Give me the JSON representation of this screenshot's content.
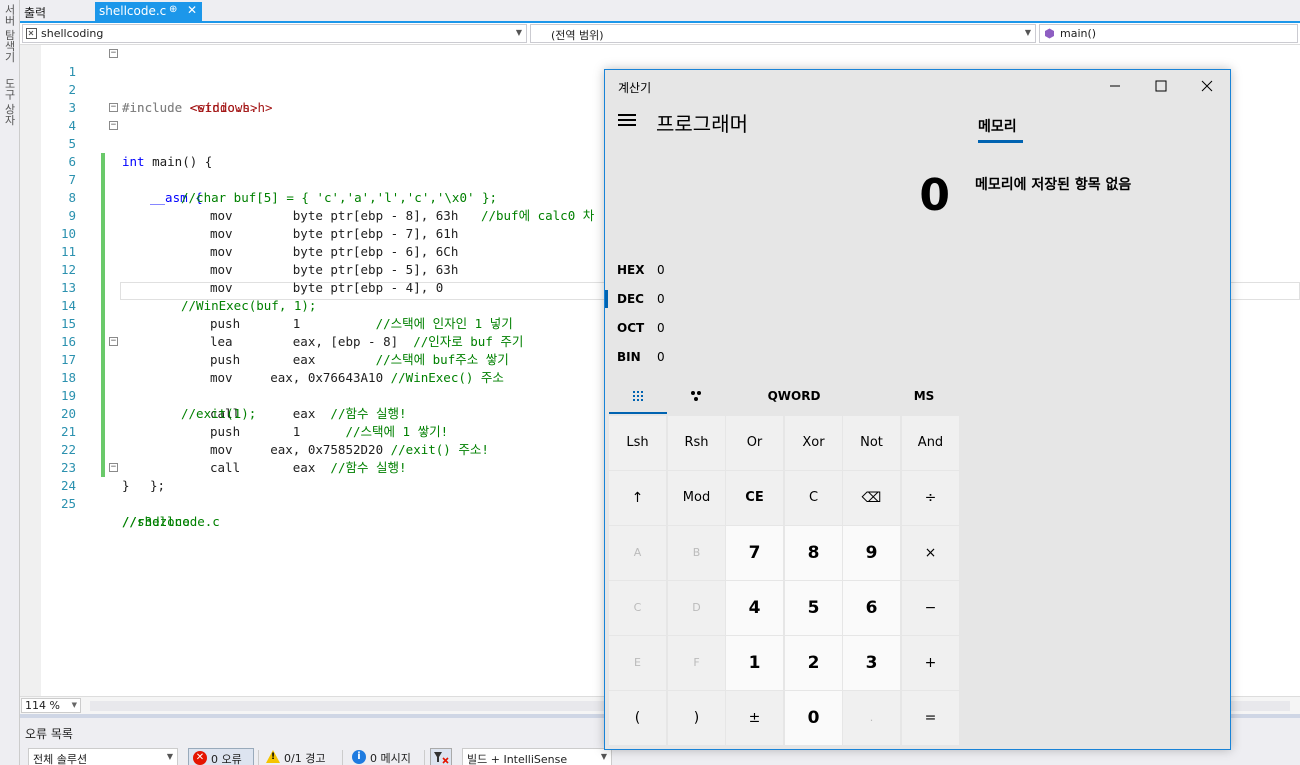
{
  "side_strip": {
    "tab1": "서버 탐색기",
    "tab2": "도구 상자"
  },
  "doc_tabs": {
    "output": "출력",
    "active": "shellcode.c",
    "pin": "⊕",
    "close": "✕"
  },
  "navbar": {
    "file_scope": "shellcoding",
    "global_scope": "(전역 범위)",
    "member": "main()"
  },
  "editor": {
    "lines": [
      {
        "n": "1"
      },
      {
        "n": "2"
      },
      {
        "n": "3"
      },
      {
        "n": "4"
      },
      {
        "n": "5"
      },
      {
        "n": "6"
      },
      {
        "n": "7"
      },
      {
        "n": "8"
      },
      {
        "n": "9"
      },
      {
        "n": "10"
      },
      {
        "n": "11"
      },
      {
        "n": "12"
      },
      {
        "n": "13"
      },
      {
        "n": "14"
      },
      {
        "n": "15"
      },
      {
        "n": "16"
      },
      {
        "n": "17"
      },
      {
        "n": "18"
      },
      {
        "n": "19"
      },
      {
        "n": "20"
      },
      {
        "n": "21"
      },
      {
        "n": "22"
      },
      {
        "n": "23"
      },
      {
        "n": "24"
      },
      {
        "n": "25"
      }
    ],
    "code": {
      "l1_a": "#include ",
      "l1_b": "<stdio.h>",
      "l2_a": "#include ",
      "l2_b": "<windows.h>",
      "l4_a": "int",
      "l4_b": " main() {",
      "l5": "__asm {",
      "l6": "//char buf[5] = { 'c','a','l','c','\\x0' };",
      "l7_a": "mov        byte ptr[ebp - 8], 63h   ",
      "l7_b": "//buf에 calc0 차",
      "l8": "mov        byte ptr[ebp - 7], 61h",
      "l9": "mov        byte ptr[ebp - 6], 6Ch",
      "l10": "mov        byte ptr[ebp - 5], 63h",
      "l11": "mov        byte ptr[ebp - 4], 0",
      "l12": "//WinExec(buf, 1);",
      "l13_a": "push       1          ",
      "l13_b": "//스택에 인자인 1 넣기",
      "l14_a": "lea        eax, [ebp - 8]  ",
      "l14_b": "//인자로 buf 주기",
      "l15_a": "push       eax        ",
      "l15_b": "//스택에 buf주소 쌓기",
      "l16_a": "mov     eax, 0x76643A10 ",
      "l16_b": "//WinExec() 주소",
      "l17_a": "call       eax  ",
      "l17_b": "//함수 실행!",
      "l18": "//exit(1);",
      "l19_a": "push       1      ",
      "l19_b": "//스택에 1 쌓기!",
      "l20_a": "mov     eax, 0x75852D20 ",
      "l20_b": "//exit() 주소!",
      "l21_a": "call       eax  ",
      "l21_b": "//함수 실행!",
      "l22": "};",
      "l23": "}",
      "l24": "//r3dzone",
      "l25": "//shellcode.c"
    }
  },
  "zoom": "114 %",
  "error_list": {
    "title": "오류 목록",
    "scope": "전체 솔루션",
    "errors": "0 오류",
    "warnings": "0/1 경고",
    "messages": "0 메시지",
    "build": "빌드 + IntelliSense"
  },
  "calculator": {
    "title": "계산기",
    "mode": "프로그래머",
    "display": "0",
    "memory_tab": "메모리",
    "memory_empty": "메모리에 저장된 항목 없음",
    "radix": [
      {
        "label": "HEX",
        "value": "0"
      },
      {
        "label": "DEC",
        "value": "0"
      },
      {
        "label": "OCT",
        "value": "0"
      },
      {
        "label": "BIN",
        "value": "0"
      }
    ],
    "word_size": "QWORD",
    "ms": "MS",
    "keys": [
      [
        "Lsh",
        "Rsh",
        "Or",
        "Xor",
        "Not",
        "And"
      ],
      [
        "↑",
        "Mod",
        "CE",
        "C",
        "⌫",
        "÷"
      ],
      [
        "A",
        "B",
        "7",
        "8",
        "9",
        "×"
      ],
      [
        "C",
        "D",
        "4",
        "5",
        "6",
        "−"
      ],
      [
        "E",
        "F",
        "1",
        "2",
        "3",
        "+"
      ],
      [
        "(",
        ")",
        "±",
        "0",
        ".",
        "="
      ]
    ]
  },
  "colors": {
    "accent": "#1c97ea",
    "calc_accent": "#0063b1",
    "change_bar": "#6ac96a"
  }
}
